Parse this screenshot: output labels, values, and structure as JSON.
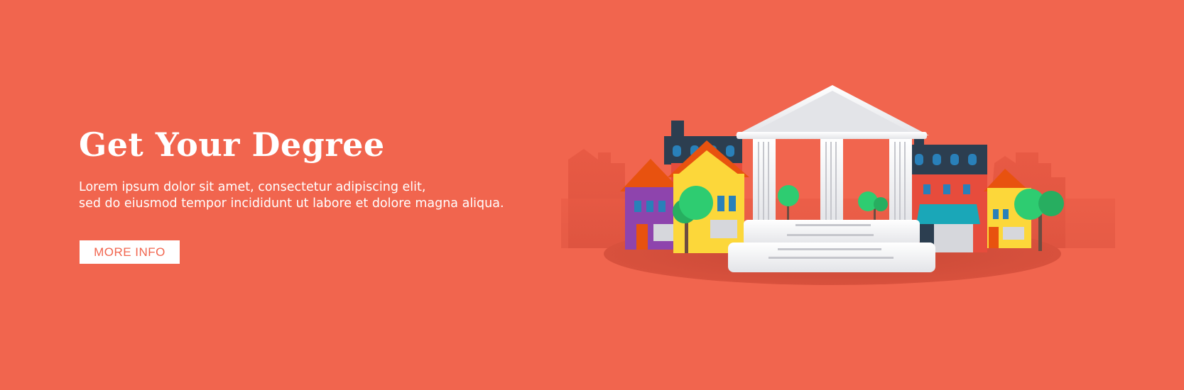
{
  "hero": {
    "title": "Get Your Degree",
    "description_line1": "Lorem ipsum dolor sit amet, consectetur adipiscing elit,",
    "description_line2": "sed do eiusmod tempor incididunt ut labore et dolore magna aliqua.",
    "button_label": "MORE INFO"
  },
  "colors": {
    "background": "#f1654e",
    "text": "#ffffff",
    "button_text": "#f1654e",
    "purple_house": "#8e44ad",
    "yellow_house": "#fcd73a",
    "navy_roof": "#2c3e50",
    "orange_roof": "#e8520f",
    "red_building": "#e74c3c",
    "tree": "#2ecc71",
    "column_building": "#ecf0f1"
  },
  "illustration": {
    "subject": "university building with columns surrounded by town houses and trees"
  }
}
